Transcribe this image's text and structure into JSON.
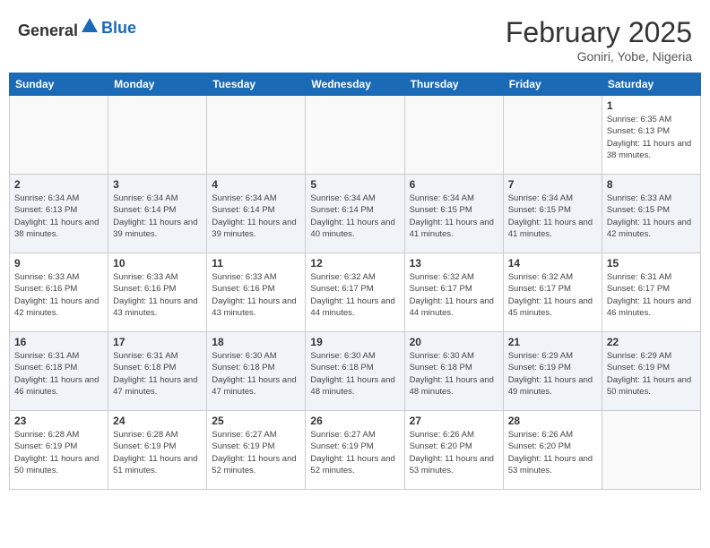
{
  "header": {
    "logo_general": "General",
    "logo_blue": "Blue",
    "month": "February 2025",
    "location": "Goniri, Yobe, Nigeria"
  },
  "weekdays": [
    "Sunday",
    "Monday",
    "Tuesday",
    "Wednesday",
    "Thursday",
    "Friday",
    "Saturday"
  ],
  "weeks": [
    [
      {
        "day": "",
        "info": ""
      },
      {
        "day": "",
        "info": ""
      },
      {
        "day": "",
        "info": ""
      },
      {
        "day": "",
        "info": ""
      },
      {
        "day": "",
        "info": ""
      },
      {
        "day": "",
        "info": ""
      },
      {
        "day": "1",
        "info": "Sunrise: 6:35 AM\nSunset: 6:13 PM\nDaylight: 11 hours and 38 minutes."
      }
    ],
    [
      {
        "day": "2",
        "info": "Sunrise: 6:34 AM\nSunset: 6:13 PM\nDaylight: 11 hours and 38 minutes."
      },
      {
        "day": "3",
        "info": "Sunrise: 6:34 AM\nSunset: 6:14 PM\nDaylight: 11 hours and 39 minutes."
      },
      {
        "day": "4",
        "info": "Sunrise: 6:34 AM\nSunset: 6:14 PM\nDaylight: 11 hours and 39 minutes."
      },
      {
        "day": "5",
        "info": "Sunrise: 6:34 AM\nSunset: 6:14 PM\nDaylight: 11 hours and 40 minutes."
      },
      {
        "day": "6",
        "info": "Sunrise: 6:34 AM\nSunset: 6:15 PM\nDaylight: 11 hours and 41 minutes."
      },
      {
        "day": "7",
        "info": "Sunrise: 6:34 AM\nSunset: 6:15 PM\nDaylight: 11 hours and 41 minutes."
      },
      {
        "day": "8",
        "info": "Sunrise: 6:33 AM\nSunset: 6:15 PM\nDaylight: 11 hours and 42 minutes."
      }
    ],
    [
      {
        "day": "9",
        "info": "Sunrise: 6:33 AM\nSunset: 6:16 PM\nDaylight: 11 hours and 42 minutes."
      },
      {
        "day": "10",
        "info": "Sunrise: 6:33 AM\nSunset: 6:16 PM\nDaylight: 11 hours and 43 minutes."
      },
      {
        "day": "11",
        "info": "Sunrise: 6:33 AM\nSunset: 6:16 PM\nDaylight: 11 hours and 43 minutes."
      },
      {
        "day": "12",
        "info": "Sunrise: 6:32 AM\nSunset: 6:17 PM\nDaylight: 11 hours and 44 minutes."
      },
      {
        "day": "13",
        "info": "Sunrise: 6:32 AM\nSunset: 6:17 PM\nDaylight: 11 hours and 44 minutes."
      },
      {
        "day": "14",
        "info": "Sunrise: 6:32 AM\nSunset: 6:17 PM\nDaylight: 11 hours and 45 minutes."
      },
      {
        "day": "15",
        "info": "Sunrise: 6:31 AM\nSunset: 6:17 PM\nDaylight: 11 hours and 46 minutes."
      }
    ],
    [
      {
        "day": "16",
        "info": "Sunrise: 6:31 AM\nSunset: 6:18 PM\nDaylight: 11 hours and 46 minutes."
      },
      {
        "day": "17",
        "info": "Sunrise: 6:31 AM\nSunset: 6:18 PM\nDaylight: 11 hours and 47 minutes."
      },
      {
        "day": "18",
        "info": "Sunrise: 6:30 AM\nSunset: 6:18 PM\nDaylight: 11 hours and 47 minutes."
      },
      {
        "day": "19",
        "info": "Sunrise: 6:30 AM\nSunset: 6:18 PM\nDaylight: 11 hours and 48 minutes."
      },
      {
        "day": "20",
        "info": "Sunrise: 6:30 AM\nSunset: 6:18 PM\nDaylight: 11 hours and 48 minutes."
      },
      {
        "day": "21",
        "info": "Sunrise: 6:29 AM\nSunset: 6:19 PM\nDaylight: 11 hours and 49 minutes."
      },
      {
        "day": "22",
        "info": "Sunrise: 6:29 AM\nSunset: 6:19 PM\nDaylight: 11 hours and 50 minutes."
      }
    ],
    [
      {
        "day": "23",
        "info": "Sunrise: 6:28 AM\nSunset: 6:19 PM\nDaylight: 11 hours and 50 minutes."
      },
      {
        "day": "24",
        "info": "Sunrise: 6:28 AM\nSunset: 6:19 PM\nDaylight: 11 hours and 51 minutes."
      },
      {
        "day": "25",
        "info": "Sunrise: 6:27 AM\nSunset: 6:19 PM\nDaylight: 11 hours and 52 minutes."
      },
      {
        "day": "26",
        "info": "Sunrise: 6:27 AM\nSunset: 6:19 PM\nDaylight: 11 hours and 52 minutes."
      },
      {
        "day": "27",
        "info": "Sunrise: 6:26 AM\nSunset: 6:20 PM\nDaylight: 11 hours and 53 minutes."
      },
      {
        "day": "28",
        "info": "Sunrise: 6:26 AM\nSunset: 6:20 PM\nDaylight: 11 hours and 53 minutes."
      },
      {
        "day": "",
        "info": ""
      }
    ]
  ]
}
